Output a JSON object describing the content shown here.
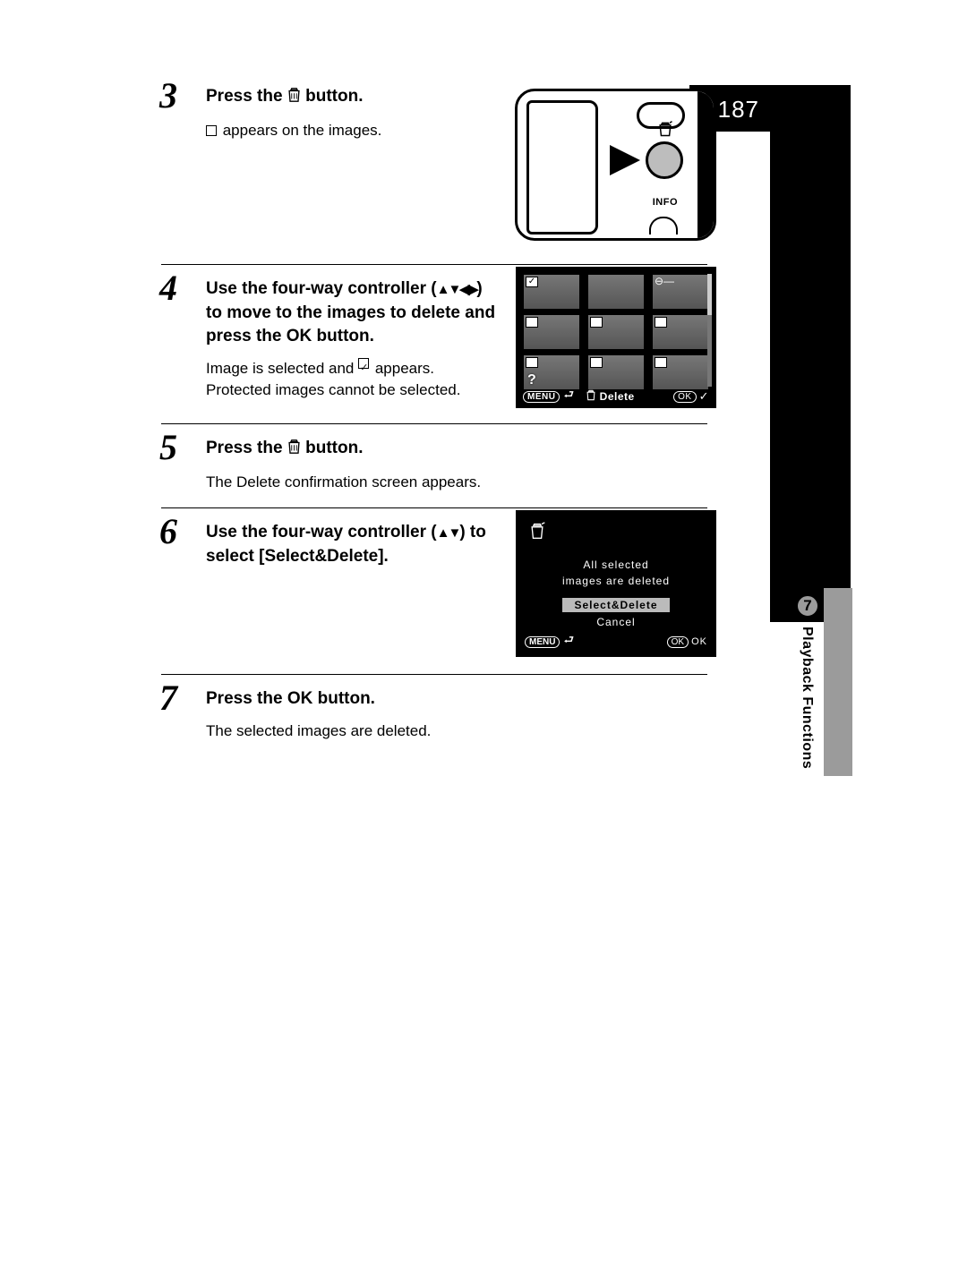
{
  "page_number": "187",
  "chapter": {
    "number": "7",
    "title": "Playback Functions"
  },
  "steps": {
    "s3": {
      "num": "3",
      "head_pre": "Press the ",
      "head_post": " button.",
      "body_pre": "",
      "body_post": " appears on the images.",
      "info_label": "INFO"
    },
    "s4": {
      "num": "4",
      "head_l1": "Use the four-way controller ",
      "head_l2_pre": "(",
      "head_l2_arrows": "▲▼◀▶",
      "head_l2_post": ") to move to the images to delete and press the ",
      "head_ok": "OK",
      "head_l3": " button.",
      "body_l1_pre": "Image is selected and ",
      "body_l1_post": " appears.",
      "body_l2": "Protected images cannot be selected.",
      "footer_menu": "MENU",
      "footer_delete": "Delete",
      "footer_ok": "OK"
    },
    "s5": {
      "num": "5",
      "head_pre": "Press the ",
      "head_post": " button.",
      "body": "The Delete confirmation screen appears."
    },
    "s6": {
      "num": "6",
      "head_l1": "Use the four-way controller ",
      "head_l2_pre": "(",
      "head_l2_arrows": "▲▼",
      "head_l2_post": ") to select [Select&Delete].",
      "dialog_msg_l1": "All selected",
      "dialog_msg_l2": "images are deleted",
      "opt_selected": "Select&Delete",
      "opt_cancel": "Cancel",
      "footer_menu": "MENU",
      "footer_ok": "OK",
      "footer_ok_text": "OK"
    },
    "s7": {
      "num": "7",
      "head_pre": "Press the ",
      "head_ok": "OK",
      "head_post": " button.",
      "body": "The selected images are deleted."
    }
  }
}
